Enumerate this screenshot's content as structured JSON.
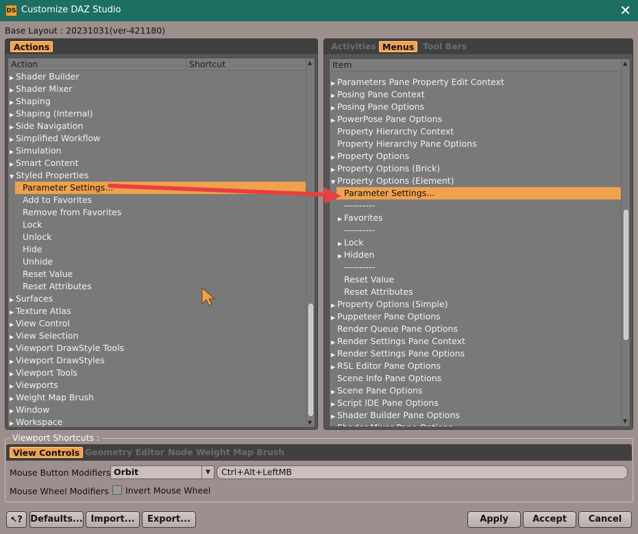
{
  "window": {
    "app_icon": "DS",
    "title": "Customize DAZ Studio",
    "close_glyph": "✕"
  },
  "base_layout": "Base Layout : 20231031(ver-421180)",
  "left_panel": {
    "tab": "Actions",
    "columns": [
      "Action",
      "Shortcut"
    ],
    "rows": [
      {
        "label": "Shader Builder",
        "expander": "▶",
        "indent": 0
      },
      {
        "label": "Shader Mixer",
        "expander": "▶",
        "indent": 0
      },
      {
        "label": "Shaping",
        "expander": "▶",
        "indent": 0
      },
      {
        "label": "Shaping (Internal)",
        "expander": "▶",
        "indent": 0
      },
      {
        "label": "Side Navigation",
        "expander": "▶",
        "indent": 0
      },
      {
        "label": "Simplified Workflow",
        "expander": "▶",
        "indent": 0
      },
      {
        "label": "Simulation",
        "expander": "▶",
        "indent": 0
      },
      {
        "label": "Smart Content",
        "expander": "▶",
        "indent": 0
      },
      {
        "label": "Styled Properties",
        "expander": "▼",
        "indent": 0
      },
      {
        "label": "Parameter Settings...",
        "expander": "",
        "indent": 1,
        "selected": true
      },
      {
        "label": "Add to Favorites",
        "expander": "",
        "indent": 1
      },
      {
        "label": "Remove from Favorites",
        "expander": "",
        "indent": 1
      },
      {
        "label": "Lock",
        "expander": "",
        "indent": 1
      },
      {
        "label": "Unlock",
        "expander": "",
        "indent": 1
      },
      {
        "label": "Hide",
        "expander": "",
        "indent": 1
      },
      {
        "label": "Unhide",
        "expander": "",
        "indent": 1
      },
      {
        "label": "Reset Value",
        "expander": "",
        "indent": 1
      },
      {
        "label": "Reset Attributes",
        "expander": "",
        "indent": 1
      },
      {
        "label": "Surfaces",
        "expander": "▶",
        "indent": 0
      },
      {
        "label": "Texture Atlas",
        "expander": "▶",
        "indent": 0
      },
      {
        "label": "View Control",
        "expander": "▶",
        "indent": 0
      },
      {
        "label": "View Selection",
        "expander": "▶",
        "indent": 0
      },
      {
        "label": "Viewport DrawStyle Tools",
        "expander": "▶",
        "indent": 0
      },
      {
        "label": "Viewport DrawStyles",
        "expander": "▶",
        "indent": 0
      },
      {
        "label": "Viewport Tools",
        "expander": "▶",
        "indent": 0
      },
      {
        "label": "Viewports",
        "expander": "▶",
        "indent": 0
      },
      {
        "label": "Weight Map Brush",
        "expander": "▶",
        "indent": 0
      },
      {
        "label": "Window",
        "expander": "▶",
        "indent": 0
      },
      {
        "label": "Workspace",
        "expander": "▶",
        "indent": 0
      }
    ]
  },
  "right_panel": {
    "tabs": [
      "Activities",
      "Menus",
      "Tool Bars"
    ],
    "active_tab": "Menus",
    "columns": [
      "Item"
    ],
    "rows": [
      {
        "label": "Parameters Pane Property Edit Context",
        "expander": "▶",
        "indent": 0
      },
      {
        "label": "Posing Pane Context",
        "expander": "▶",
        "indent": 0
      },
      {
        "label": "Posing Pane Options",
        "expander": "▶",
        "indent": 0
      },
      {
        "label": "PowerPose Pane Options",
        "expander": "▶",
        "indent": 0
      },
      {
        "label": "Property Hierarchy Context",
        "expander": "",
        "indent": 0
      },
      {
        "label": "Property Hierarchy Pane Options",
        "expander": "",
        "indent": 0
      },
      {
        "label": "Property Options",
        "expander": "▶",
        "indent": 0
      },
      {
        "label": "Property Options (Brick)",
        "expander": "▶",
        "indent": 0
      },
      {
        "label": "Property Options (Element)",
        "expander": "▼",
        "indent": 0
      },
      {
        "label": "Parameter Settings...",
        "expander": "",
        "indent": 1,
        "selected": true
      },
      {
        "label": "----------",
        "expander": "",
        "indent": 1
      },
      {
        "label": "Favorites",
        "expander": "▶",
        "indent": 1
      },
      {
        "label": "----------",
        "expander": "",
        "indent": 1
      },
      {
        "label": "Lock",
        "expander": "▶",
        "indent": 1
      },
      {
        "label": "Hidden",
        "expander": "▶",
        "indent": 1
      },
      {
        "label": "----------",
        "expander": "",
        "indent": 1
      },
      {
        "label": "Reset Value",
        "expander": "",
        "indent": 1
      },
      {
        "label": "Reset Attributes",
        "expander": "",
        "indent": 1
      },
      {
        "label": "Property Options (Simple)",
        "expander": "▶",
        "indent": 0
      },
      {
        "label": "Puppeteer Pane Options",
        "expander": "▶",
        "indent": 0
      },
      {
        "label": "Render Queue Pane Options",
        "expander": "",
        "indent": 0
      },
      {
        "label": "Render Settings Pane Context",
        "expander": "▶",
        "indent": 0
      },
      {
        "label": "Render Settings Pane Options",
        "expander": "▶",
        "indent": 0
      },
      {
        "label": "RSL Editor Pane Options",
        "expander": "▶",
        "indent": 0
      },
      {
        "label": "Scene Info Pane Options",
        "expander": "",
        "indent": 0
      },
      {
        "label": "Scene Pane Options",
        "expander": "▶",
        "indent": 0
      },
      {
        "label": "Script IDE Pane Options",
        "expander": "▶",
        "indent": 0
      },
      {
        "label": "Shader Builder Pane Options",
        "expander": "▶",
        "indent": 0
      },
      {
        "label": "Shader Mixer Pane Options",
        "expander": "▶",
        "indent": 0
      }
    ]
  },
  "viewport_shortcuts": {
    "legend": "Viewport Shortcuts :",
    "tabs": [
      "View Controls",
      "Geometry Editor",
      "Node Weight Map Brush"
    ],
    "active_tab": "View Controls",
    "mouse_button_label": "Mouse Button Modifiers :",
    "mouse_button_value": "Orbit",
    "mouse_button_shortcut": "Ctrl+Alt+LeftMB",
    "mouse_wheel_label": "Mouse Wheel Modifiers :",
    "invert_label": "Invert Mouse Wheel",
    "invert_checked": false
  },
  "buttons": {
    "help": "?",
    "defaults": "Defaults...",
    "import": "Import...",
    "export": "Export...",
    "apply": "Apply",
    "accept": "Accept",
    "cancel": "Cancel"
  },
  "colors": {
    "title_bar": "#1c6f62",
    "selection": "#f0a14e",
    "dialog_bg": "#9c8f8d",
    "annotation_arrow": "#e8403e"
  },
  "icons": {
    "expander_collapsed": "triangle-right-icon",
    "expander_expanded": "triangle-down-icon",
    "annotation": "red-arrow-icon",
    "cursor": "mouse-cursor-icon"
  }
}
